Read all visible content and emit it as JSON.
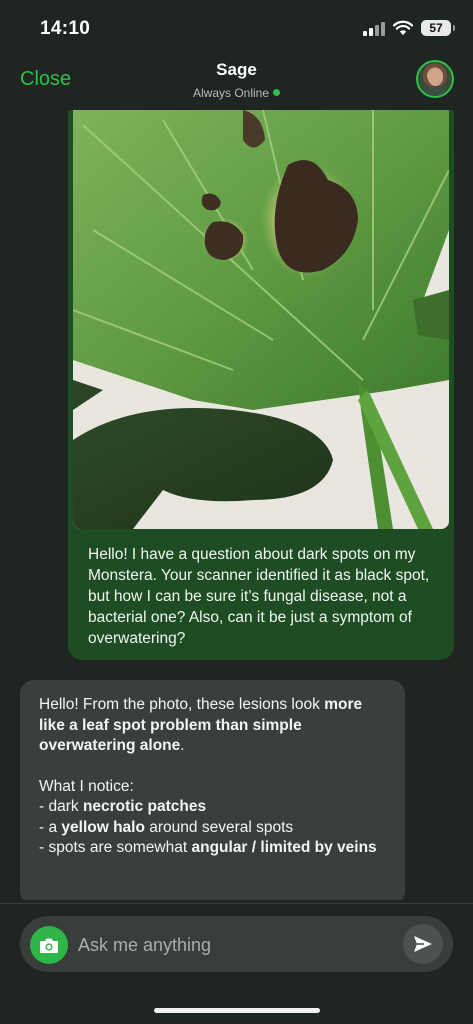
{
  "status_bar": {
    "time": "14:10",
    "battery": "57"
  },
  "header": {
    "close_label": "Close",
    "title": "Sage",
    "status": "Always Online"
  },
  "messages": {
    "user": {
      "text": "Hello! I have a question about dark spots on my Monstera. Your scanner identified it as black spot, but how I can be sure it’s fungal disease, not a bacterial one? Also, can it be just a symptom of overwatering?"
    },
    "assistant": {
      "intro_prefix": "Hello! From the photo, these lesions look ",
      "intro_bold": "more like a leaf spot problem than simple overwatering alone",
      "intro_suffix": ".",
      "notice_heading": "What I notice:",
      "item1_prefix": "- dark ",
      "item1_bold": "necrotic patches",
      "item2_prefix": "- a ",
      "item2_bold": "yellow halo",
      "item2_suffix": " around several spots",
      "item3_prefix": "- spots are somewhat ",
      "item3_bold": "angular / limited by veins"
    }
  },
  "composer": {
    "placeholder": "Ask me anything"
  },
  "colors": {
    "background": "#1f2521",
    "accent": "#2fc04a",
    "user_bubble": "#1e4c23",
    "assistant_bubble": "#3a3f3c"
  },
  "icons": [
    "signal-icon",
    "wifi-icon",
    "battery-icon",
    "online-dot-icon",
    "camera-icon",
    "send-icon"
  ]
}
